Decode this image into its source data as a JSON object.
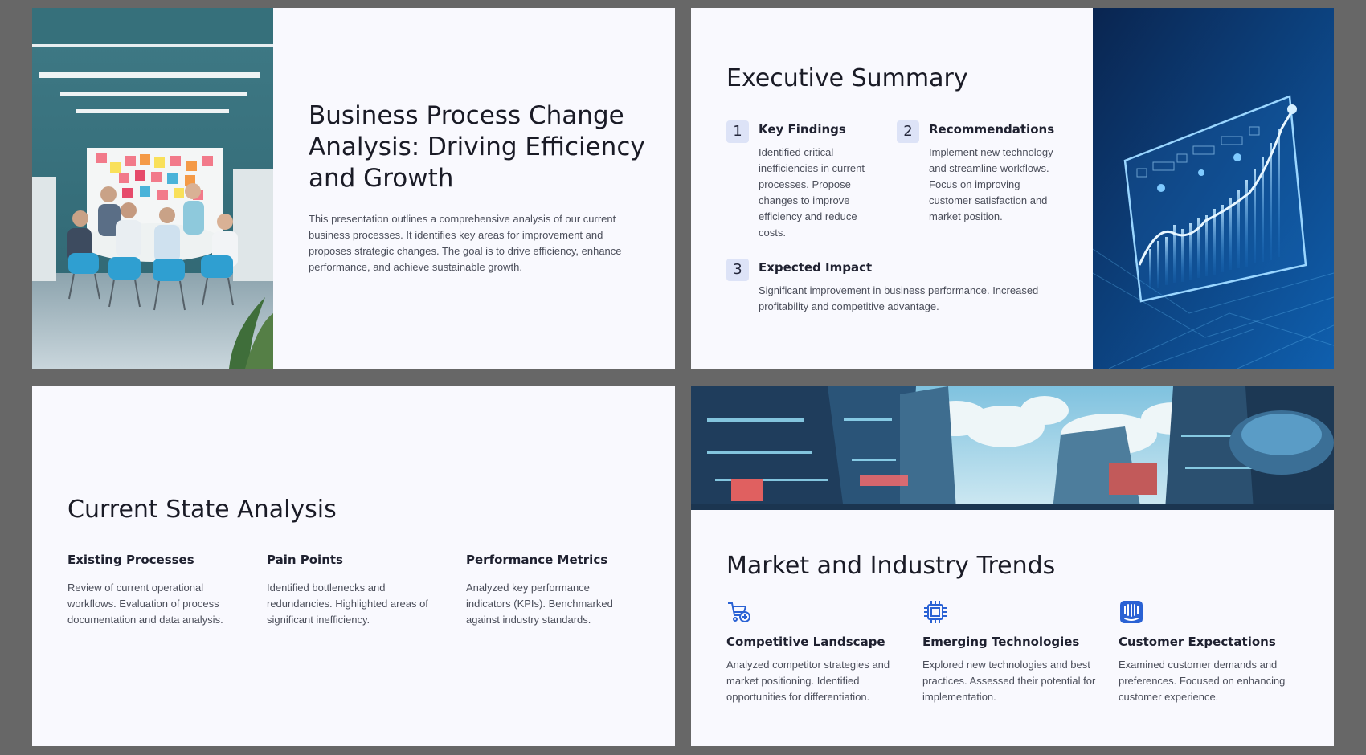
{
  "slide1": {
    "title": "Business Process Change Analysis: Driving Efficiency and Growth",
    "description": "This presentation outlines a comprehensive analysis of our current business processes. It identifies key areas for improvement and proposes strategic changes. The goal is to drive efficiency, enhance performance, and achieve sustainable growth."
  },
  "slide2": {
    "title": "Executive Summary",
    "items": [
      {
        "number": "1",
        "title": "Key Findings",
        "text": "Identified critical inefficiencies in current processes. Propose changes to improve efficiency and reduce costs."
      },
      {
        "number": "2",
        "title": "Recommendations",
        "text": "Implement new technology and streamline workflows. Focus on improving customer satisfaction and market position."
      },
      {
        "number": "3",
        "title": "Expected Impact",
        "text": "Significant improvement in business performance. Increased profitability and competitive advantage."
      }
    ]
  },
  "slide3": {
    "title": "Current State Analysis",
    "columns": [
      {
        "title": "Existing Processes",
        "text": "Review of current operational workflows. Evaluation of process documentation and data analysis."
      },
      {
        "title": "Pain Points",
        "text": "Identified bottlenecks and redundancies. Highlighted areas of significant inefficiency."
      },
      {
        "title": "Performance Metrics",
        "text": "Analyzed key performance indicators (KPIs). Benchmarked against industry standards."
      }
    ]
  },
  "slide4": {
    "title": "Market and Industry Trends",
    "columns": [
      {
        "icon": "cart-plus-icon",
        "title": "Competitive Landscape",
        "text": "Analyzed competitor strategies and market positioning. Identified opportunities for differentiation."
      },
      {
        "icon": "chip-icon",
        "title": "Emerging Technologies",
        "text": "Explored new technologies and best practices. Assessed their potential for implementation."
      },
      {
        "icon": "intercom-icon",
        "title": "Customer Expectations",
        "text": "Examined customer demands and preferences. Focused on enhancing customer experience."
      }
    ]
  },
  "colors": {
    "background": "#676767",
    "slide": "#f9f9fe",
    "accent": "#2a62d4",
    "badge": "#dde3f7"
  }
}
